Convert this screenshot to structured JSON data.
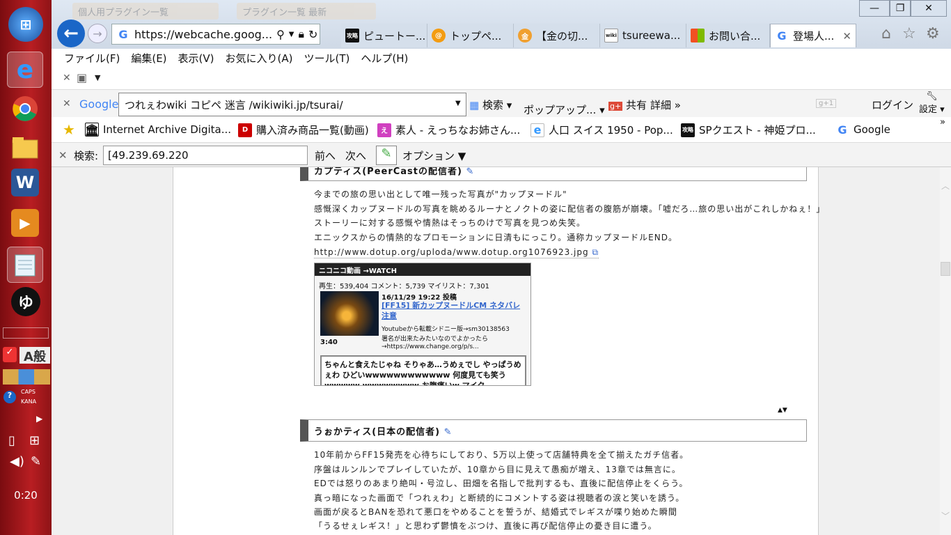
{
  "taskbar": {
    "clock": "0:20",
    "ime_mode": "A",
    "ime_conv": "般",
    "caps": "CAPS",
    "kana": "KANA"
  },
  "browser": {
    "ghost_tabs": [
      "個人用プラグイン一覧",
      "プラグイン一覧 最新"
    ],
    "address": "https://webcache.goog...",
    "tabs": [
      {
        "label": "ピュートー...",
        "icon": "攻略wiki"
      },
      {
        "label": "トップペ...",
        "icon": "@"
      },
      {
        "label": "【金の切...",
        "icon": "金"
      },
      {
        "label": "tsureewa...",
        "icon": "wiki"
      },
      {
        "label": "お問い合...",
        "icon": "ms"
      },
      {
        "label": "登場人...",
        "icon": "G"
      }
    ],
    "menu": [
      "ファイル(F)",
      "編集(E)",
      "表示(V)",
      "お気に入り(A)",
      "ツール(T)",
      "ヘルプ(H)"
    ],
    "google_toolbar": {
      "logo": "Google",
      "query": "つれぇわwiki コピペ 迷言 /wikiwiki.jp/tsurai/",
      "search_label": "検索",
      "popup_label": "ポップアップ...",
      "share_label": "共有",
      "detail_label": "詳細 »",
      "login_label": "ログイン",
      "settings_label": "設定"
    },
    "favorites": [
      "Internet Archive Digita...",
      "購入済み商品一覧(動画)",
      "素人 - えっちなお姉さん...",
      "人口 スイス 1950 - Pop...",
      "SPクエスト - 神姫プロ...",
      "Google"
    ],
    "find": {
      "label": "検索:",
      "value": "[49.239.69.220",
      "prev": "前へ",
      "next": "次へ",
      "options": "オプション"
    }
  },
  "article": {
    "section1": {
      "title": "カプティス(PeerCastの配信者)",
      "lines": [
        "今までの旅の思い出として唯一残った写真が\"カップヌードル\"",
        "感慨深くカップヌードルの写真を眺めるルーナとノクトの姿に配信者の腹筋が崩壊。「嘘だろ…旅の思い出がこれしかねぇ！」",
        "ストーリーに対する感慨や情熱はそっちのけで写真を見つめ失笑。",
        "エニックスからの情熱的なプロモーションに日清もにっこり。通称カップヌードルEND。"
      ],
      "link": "http://www.dotup.org/uploda/www.dotup.org1076923.jpg"
    },
    "nico": {
      "header": "ニコニコ動画 →WATCH",
      "stats": "再生：539,404 コメント：5,739 マイリスト：7,301",
      "date": "16/11/29 19:22 投稿",
      "title": "[FF15] 新カップヌードルCM ネタバレ注意",
      "desc1": "Youtubeから転載シドニー版→sm30138563",
      "desc2": "署名が出来たみたいなのでよかったら",
      "desc3": "→https://www.change.org/p/s...",
      "duration": "3:40",
      "comments": "ちゃんと食えたじゃね そりゃあ…うめぇでし やっぱうめぇわ ひどいwwwwwwwwwwww 何度見ても笑うwwwww wwwwwwww お腹痛いw マイク"
    },
    "section2": {
      "title": "うぉかティス(日本の配信者)",
      "lines": [
        "10年前からFF15発売を心待ちにしており、5万以上使って店舗特典を全て揃えたガチ信者。",
        "序盤はルンルンでプレイしていたが、10章から目に見えて愚痴が増え、13章では無言に。",
        "EDでは怒りのあまり絶叫・号泣し、田畑を名指しで批判するも、直後に配信停止をくらう。",
        "真っ暗になった画面で「つれぇわ」と断続的にコメントする姿は視聴者の涙と笑いを誘う。",
        "画面が戻るとBANを恐れて悪口をやめることを誓うが、結婚式でレギスが喋り始めた瞬間",
        "「うるせぇレギス！」と思わず鬱憤をぶつけ、直後に再び配信停止の憂き目に遭う。"
      ]
    }
  }
}
